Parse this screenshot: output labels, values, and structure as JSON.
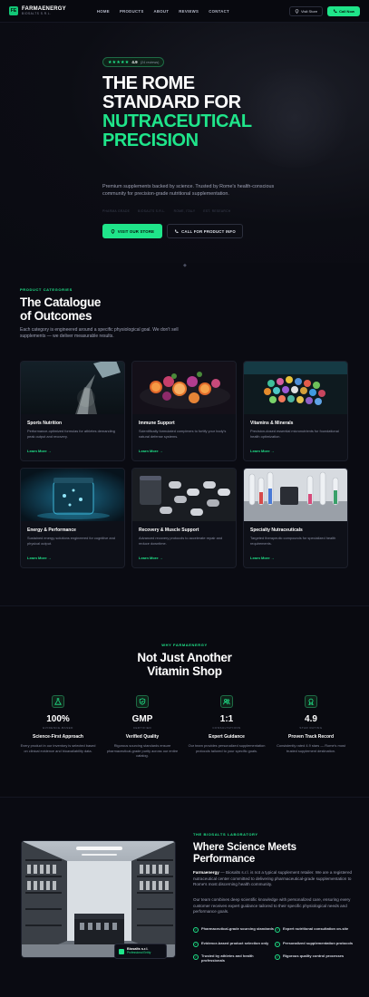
{
  "nav": {
    "logo_mark": "FE",
    "brand": "FARMAENERGY",
    "brand_sub": "BIOSALTS S.R.L.",
    "links": [
      "HOME",
      "PRODUCTS",
      "ABOUT",
      "REVIEWS",
      "CONTACT"
    ],
    "visit_label": "Visit Store",
    "call_label": "Call Now"
  },
  "hero": {
    "stars": "★★★★★",
    "rating": "4.9",
    "rating_count": "(24 reviews)",
    "title_lines": [
      "THE ROME",
      "STANDARD FOR"
    ],
    "title_accent_lines": [
      "NUTRACEUTICAL",
      "PRECISION"
    ],
    "description": "Premium supplements backed by science. Trusted by Rome's health-conscious community for precision-grade nutritional supplementation.",
    "badges": [
      "PHARMA GRADE",
      "BIOSALTS S.R.L.",
      "ROME, ITALY",
      "EST. RESEARCH"
    ],
    "cta_visit": "VISIT OUR STORE",
    "cta_call": "CALL FOR PRODUCT INFO",
    "scroll_glyph": "◆"
  },
  "catalogue": {
    "eyebrow": "PRODUCT CATEGORIES",
    "title_lines": [
      "The Catalogue",
      "of Outcomes"
    ],
    "description": "Each category is engineered around a specific physiological goal. We don't sell supplements — we deliver measurable results.",
    "link_label": "Learn More →",
    "cards": [
      {
        "title": "Sports Nutrition",
        "desc": "Performance-optimized formulas for athletes demanding peak output and recovery."
      },
      {
        "title": "Immune Support",
        "desc": "Scientifically formulated complexes to fortify your body's natural defense systems."
      },
      {
        "title": "Vitamins & Minerals",
        "desc": "Precision-dosed essential micronutrients for foundational health optimization."
      },
      {
        "title": "Energy & Performance",
        "desc": "Sustained energy solutions engineered for cognitive and physical output."
      },
      {
        "title": "Recovery & Muscle Support",
        "desc": "Advanced recovery protocols to accelerate repair and reduce downtime."
      },
      {
        "title": "Specialty Nutraceuticals",
        "desc": "Targeted therapeutic compounds for specialized health requirements."
      }
    ]
  },
  "why": {
    "eyebrow": "WHY FARMAENERGY",
    "title_lines": [
      "Not Just Another",
      "Vitamin Shop"
    ],
    "stats": [
      {
        "icon": "flask-icon",
        "value": "100%",
        "label": "EVIDENCE-BASED",
        "title": "Science-First Approach",
        "desc": "Every product in our inventory is selected based on clinical evidence and bioavailability data."
      },
      {
        "icon": "shield-check-icon",
        "value": "GMP",
        "label": "CERTIFIED",
        "title": "Verified Quality",
        "desc": "Rigorous sourcing standards ensure pharmaceutical-grade purity across our entire catalog."
      },
      {
        "icon": "users-icon",
        "value": "1:1",
        "label": "CONSULTATIONS",
        "title": "Expert Guidance",
        "desc": "Our team provides personalized supplementation protocols tailored to your specific goals."
      },
      {
        "icon": "award-icon",
        "value": "4.9",
        "label": "STAR RATING",
        "title": "Proven Track Record",
        "desc": "Consistently rated 4.9 stars — Rome's most trusted supplement destination."
      }
    ]
  },
  "lab": {
    "eyebrow": "THE BIOSALTS LABORATORY",
    "title_lines": [
      "Where Science Meets",
      "Performance"
    ],
    "p1_lead": "Farmaenergy",
    "p1": " — Biosalts s.r.l. is not a typical supplement retailer. We are a registered nutraceutical center committed to delivering pharmaceutical-grade supplementation to Rome's most discerning health community.",
    "p2": "Our team combines deep scientific knowledge with personalized care, ensuring every customer receives expert guidance tailored to their specific physiological needs and performance goals.",
    "checks": [
      "Pharmaceutical-grade sourcing standards",
      "Expert nutritional consultation on-site",
      "Evidence-based product selection only",
      "Personalized supplementation protocols",
      "Trusted by athletes and health professionals",
      "Rigorous quality control processes"
    ],
    "tag_name": "Biosalts s.r.l.",
    "tag_sub": "Professional Entity"
  },
  "colors": {
    "accent": "#1fe58a",
    "background": "#0a0b12",
    "card": "#0e1018"
  }
}
